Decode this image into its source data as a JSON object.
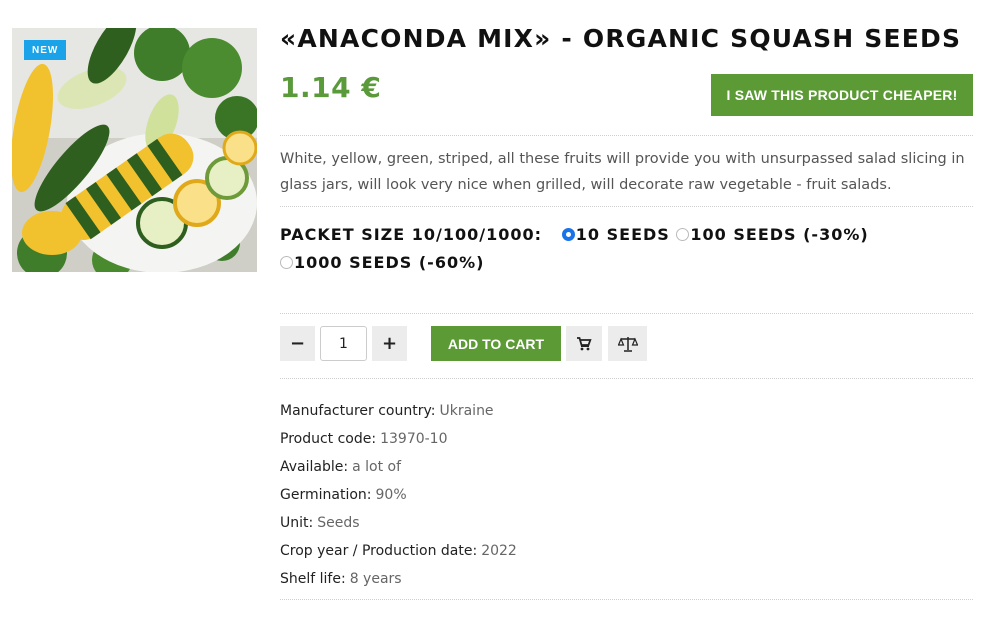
{
  "product": {
    "badge": "NEW",
    "title": "«ANACONDA MIX» - ORGANIC SQUASH SEEDS",
    "price": "1.14 €",
    "cheaper_label": "I SAW THIS PRODUCT CHEAPER!",
    "description": "White, yellow, green, striped, all these fruits will provide you with unsurpassed salad slicing in glass jars, will look very nice when grilled, will decorate raw vegetable - fruit salads."
  },
  "packet": {
    "label": "PACKET SIZE 10/100/1000:",
    "options": [
      {
        "label": "10 SEEDS",
        "checked": true
      },
      {
        "label": "100 SEEDS (-30%)",
        "checked": false
      },
      {
        "label": "1000 SEEDS (-60%)",
        "checked": false
      }
    ]
  },
  "cart": {
    "minus": "−",
    "quantity": "1",
    "plus": "+",
    "add_label": "ADD TO CART",
    "icons": [
      "cart-icon",
      "scales-icon"
    ]
  },
  "specs": [
    {
      "label": "Manufacturer country:",
      "value": "Ukraine"
    },
    {
      "label": "Product code:",
      "value": "13970-10"
    },
    {
      "label": "Available:",
      "value": "a lot of"
    },
    {
      "label": "Germination:",
      "value": "90%"
    },
    {
      "label": "Unit:",
      "value": "Seeds"
    },
    {
      "label": "Crop year / Production date:",
      "value": "2022"
    },
    {
      "label": "Shelf life:",
      "value": "8 years"
    }
  ],
  "colors": {
    "accent_green": "#5c9a36",
    "price_green": "#5a9a3a",
    "badge_blue": "#1aa3e8",
    "radio_blue": "#1a73e8"
  }
}
